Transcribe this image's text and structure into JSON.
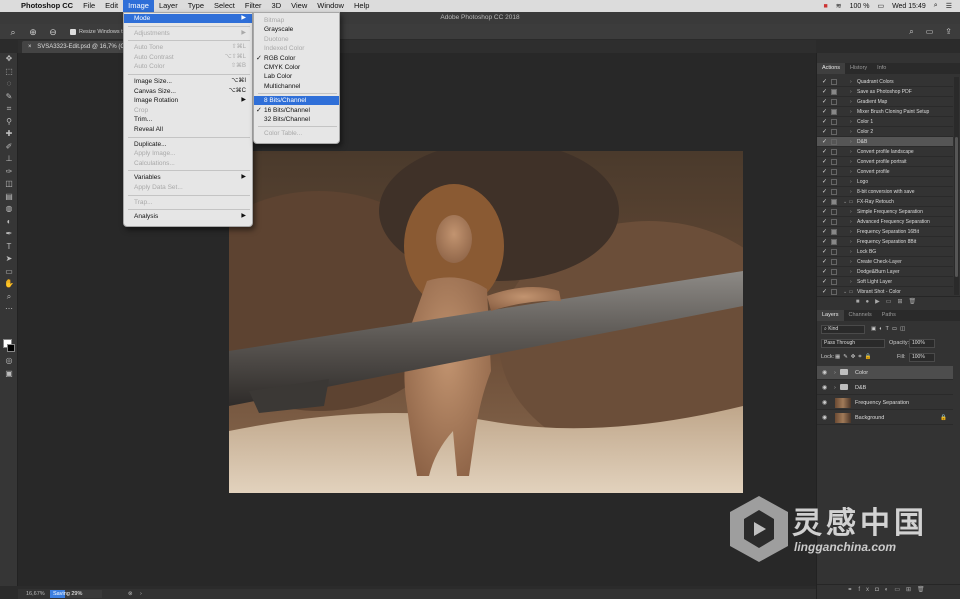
{
  "menubar": {
    "app": "Photoshop CC",
    "items": [
      "File",
      "Edit",
      "Image",
      "Layer",
      "Type",
      "Select",
      "Filter",
      "3D",
      "View",
      "Window",
      "Help"
    ],
    "active": "Image",
    "battery": "100 %",
    "clock": "Wed 15:49"
  },
  "window_title": "Adobe Photoshop CC 2018",
  "options": {
    "resize_windows_label": "Resize Windows to Fi"
  },
  "document_tab": "SVSA3323-Edit.psd @ 16,7% (C",
  "image_menu": [
    {
      "label": "Mode",
      "submenu": true,
      "highlight": true
    },
    {
      "sep": true
    },
    {
      "label": "Adjustments",
      "submenu": true,
      "disabled": true
    },
    {
      "sep": true
    },
    {
      "label": "Auto Tone",
      "shortcut": "⇧⌘L",
      "disabled": true
    },
    {
      "label": "Auto Contrast",
      "shortcut": "⌥⇧⌘L",
      "disabled": true
    },
    {
      "label": "Auto Color",
      "shortcut": "⇧⌘B",
      "disabled": true
    },
    {
      "sep": true
    },
    {
      "label": "Image Size...",
      "shortcut": "⌥⌘I"
    },
    {
      "label": "Canvas Size...",
      "shortcut": "⌥⌘C"
    },
    {
      "label": "Image Rotation",
      "submenu": true
    },
    {
      "label": "Crop",
      "disabled": true
    },
    {
      "label": "Trim..."
    },
    {
      "label": "Reveal All"
    },
    {
      "sep": true
    },
    {
      "label": "Duplicate..."
    },
    {
      "label": "Apply Image...",
      "disabled": true
    },
    {
      "label": "Calculations...",
      "disabled": true
    },
    {
      "sep": true
    },
    {
      "label": "Variables",
      "submenu": true
    },
    {
      "label": "Apply Data Set...",
      "disabled": true
    },
    {
      "sep": true
    },
    {
      "label": "Trap...",
      "disabled": true
    },
    {
      "sep": true
    },
    {
      "label": "Analysis",
      "submenu": true
    }
  ],
  "mode_menu": [
    {
      "label": "Bitmap",
      "disabled": true
    },
    {
      "label": "Grayscale"
    },
    {
      "label": "Duotone",
      "disabled": true
    },
    {
      "label": "Indexed Color",
      "disabled": true
    },
    {
      "label": "RGB Color",
      "checked": true
    },
    {
      "label": "CMYK Color"
    },
    {
      "label": "Lab Color"
    },
    {
      "label": "Multichannel"
    },
    {
      "sep": true
    },
    {
      "label": "8 Bits/Channel",
      "highlight": true
    },
    {
      "label": "16 Bits/Channel",
      "checked": true
    },
    {
      "label": "32 Bits/Channel"
    },
    {
      "sep": true
    },
    {
      "label": "Color Table...",
      "disabled": true
    }
  ],
  "actions_panel": {
    "tabs": [
      "Actions",
      "History",
      "Info"
    ],
    "rows": [
      {
        "label": "Quadrant Colors",
        "dialog": false
      },
      {
        "label": "Save as Photoshop PDF",
        "dialog": true
      },
      {
        "label": "Gradient Map",
        "dialog": false
      },
      {
        "label": "Mixer Brush Cloning Paint Setup",
        "dialog": true
      },
      {
        "label": "Color 1",
        "dialog": false
      },
      {
        "label": "Color 2",
        "dialog": false
      },
      {
        "label": "D&B",
        "dialog": false,
        "selected": true
      },
      {
        "label": "Convert profile landscape",
        "dialog": false
      },
      {
        "label": "Convert profile portrait",
        "dialog": false
      },
      {
        "label": "Convert profile",
        "dialog": false
      },
      {
        "label": "Logo",
        "dialog": false
      },
      {
        "label": "8-bit conversion with save",
        "dialog": false
      },
      {
        "label": "FX-Ray Retouch",
        "dialog": true,
        "set": true
      },
      {
        "label": "Simple Frequency Separation",
        "dialog": false
      },
      {
        "label": "Advanced Frequency Separation",
        "dialog": false
      },
      {
        "label": "Frequency Separation 16Bit",
        "dialog": true
      },
      {
        "label": "Frequency Separation 8Bit",
        "dialog": true
      },
      {
        "label": "Lock BG",
        "dialog": false
      },
      {
        "label": "Create Check-Layer",
        "dialog": false
      },
      {
        "label": "Dodge&Burn Layer",
        "dialog": false
      },
      {
        "label": "Soft Light Layer",
        "dialog": false
      },
      {
        "label": "Vibrant Shot - Color",
        "dialog": false,
        "set": true
      }
    ]
  },
  "layers_panel": {
    "tabs": [
      "Layers",
      "Channels",
      "Paths"
    ],
    "kind_filter": "Kind",
    "blend_mode": "Pass Through",
    "opacity_label": "Opacity:",
    "opacity": "100%",
    "lock_label": "Lock:",
    "fill_label": "Fill:",
    "fill": "100%",
    "layers": [
      {
        "name": "Color",
        "type": "group",
        "selected": true
      },
      {
        "name": "D&B",
        "type": "group"
      },
      {
        "name": "Frequency Separation",
        "type": "pixel"
      },
      {
        "name": "Background",
        "type": "pixel",
        "locked": true
      }
    ]
  },
  "status": {
    "zoom": "16,67%",
    "progress_text": "Saving 29%",
    "progress": 0.29
  },
  "watermark": {
    "cn": "灵感中国",
    "en": "lingganchina.com"
  },
  "colors": {
    "menu_highlight": "#2f6fd8",
    "progress": "#3c7fe0"
  }
}
